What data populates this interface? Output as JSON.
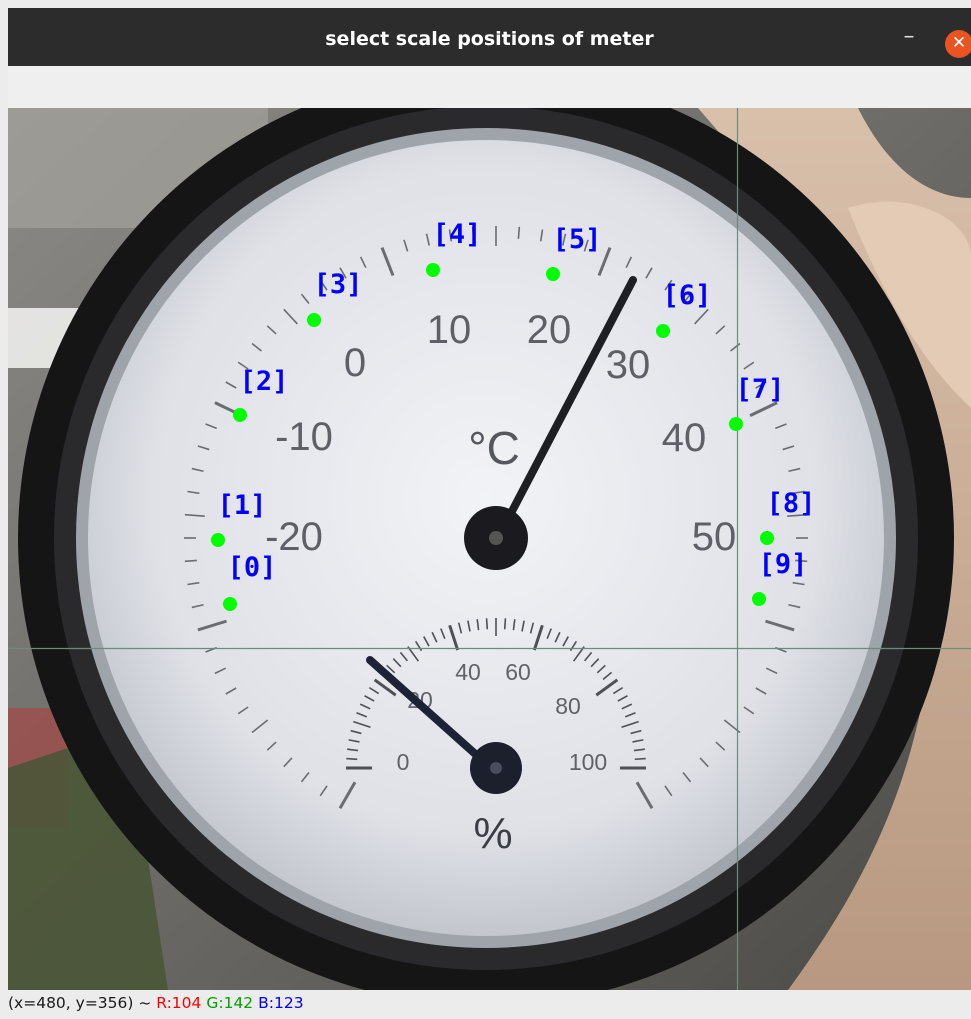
{
  "window": {
    "title": "select scale positions of meter",
    "minimize_glyph": "–",
    "close_glyph": "✕"
  },
  "meter": {
    "celsius_unit": "°C",
    "celsius_ticks": [
      "-20",
      "-10",
      "0",
      "10",
      "20",
      "30",
      "40",
      "50"
    ],
    "humidity_unit": "%",
    "humidity_ticks": [
      "0",
      "20",
      "40",
      "60",
      "80",
      "100"
    ]
  },
  "points": [
    {
      "label": "[0]"
    },
    {
      "label": "[1]"
    },
    {
      "label": "[2]"
    },
    {
      "label": "[3]"
    },
    {
      "label": "[4]"
    },
    {
      "label": "[5]"
    },
    {
      "label": "[6]"
    },
    {
      "label": "[7]"
    },
    {
      "label": "[8]"
    },
    {
      "label": "[9]"
    }
  ],
  "status": {
    "coords": "(x=480, y=356) ~",
    "r": "R:104",
    "g": "G:142",
    "b": "B:123"
  },
  "colors": {
    "point": "#00ff00",
    "point_label": "#0000ff",
    "crosshair": "#688e7b",
    "status_r": "#ff0000",
    "status_g": "#00a000",
    "status_b": "#0000ff"
  }
}
